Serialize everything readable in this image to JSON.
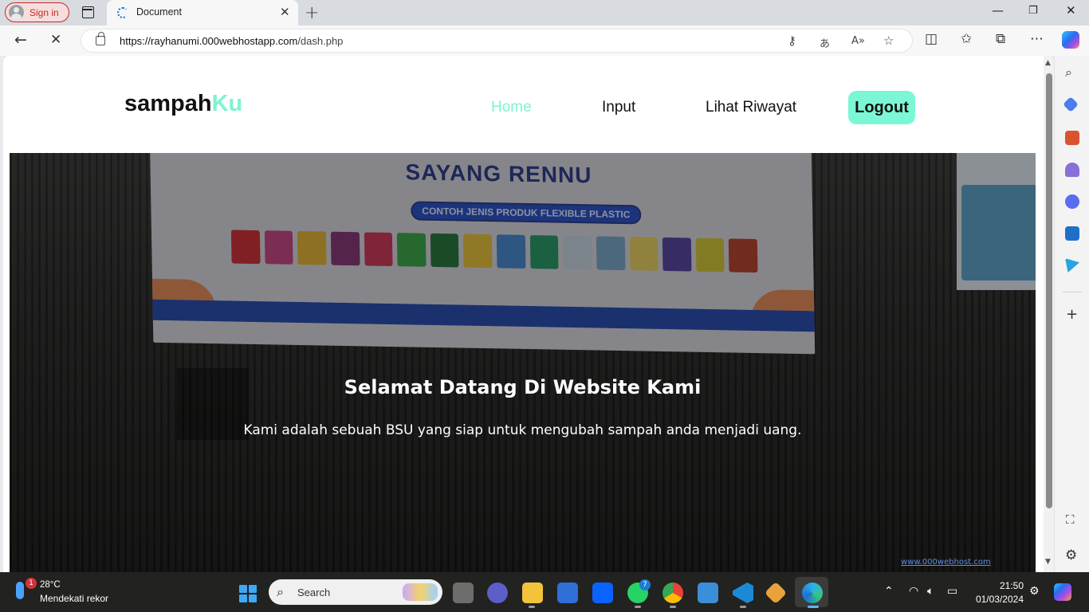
{
  "browser": {
    "signin_label": "Sign in",
    "tab_title": "Document",
    "url_host": "https://rayhanumi.000webhostapp.com",
    "url_path": "/dash.php"
  },
  "site": {
    "brand_main": "sampah",
    "brand_accent": "Ku",
    "nav": {
      "home": "Home",
      "input": "Input",
      "history": "Lihat Riwayat",
      "logout": "Logout"
    },
    "hero": {
      "title": "Selamat Datang Di Website Kami",
      "subtitle": "Kami adalah sebuah BSU yang siap untuk mengubah sampah anda menjadi uang.",
      "banner_heading": "SAYANG RENNU",
      "banner_pill": "CONTOH JENIS PRODUK FLEXIBLE PLASTIC",
      "footer_badge": "www.000webhost.com"
    },
    "colors": {
      "accent": "#7cf3d1",
      "logout_bg": "#7cf7d5"
    }
  },
  "taskbar": {
    "weather_temp": "28°C",
    "weather_desc": "Mendekati rekor",
    "weather_alert_count": "1",
    "search_placeholder": "Search",
    "whatsapp_badge": "7",
    "time": "21:50",
    "date": "01/03/2024"
  }
}
